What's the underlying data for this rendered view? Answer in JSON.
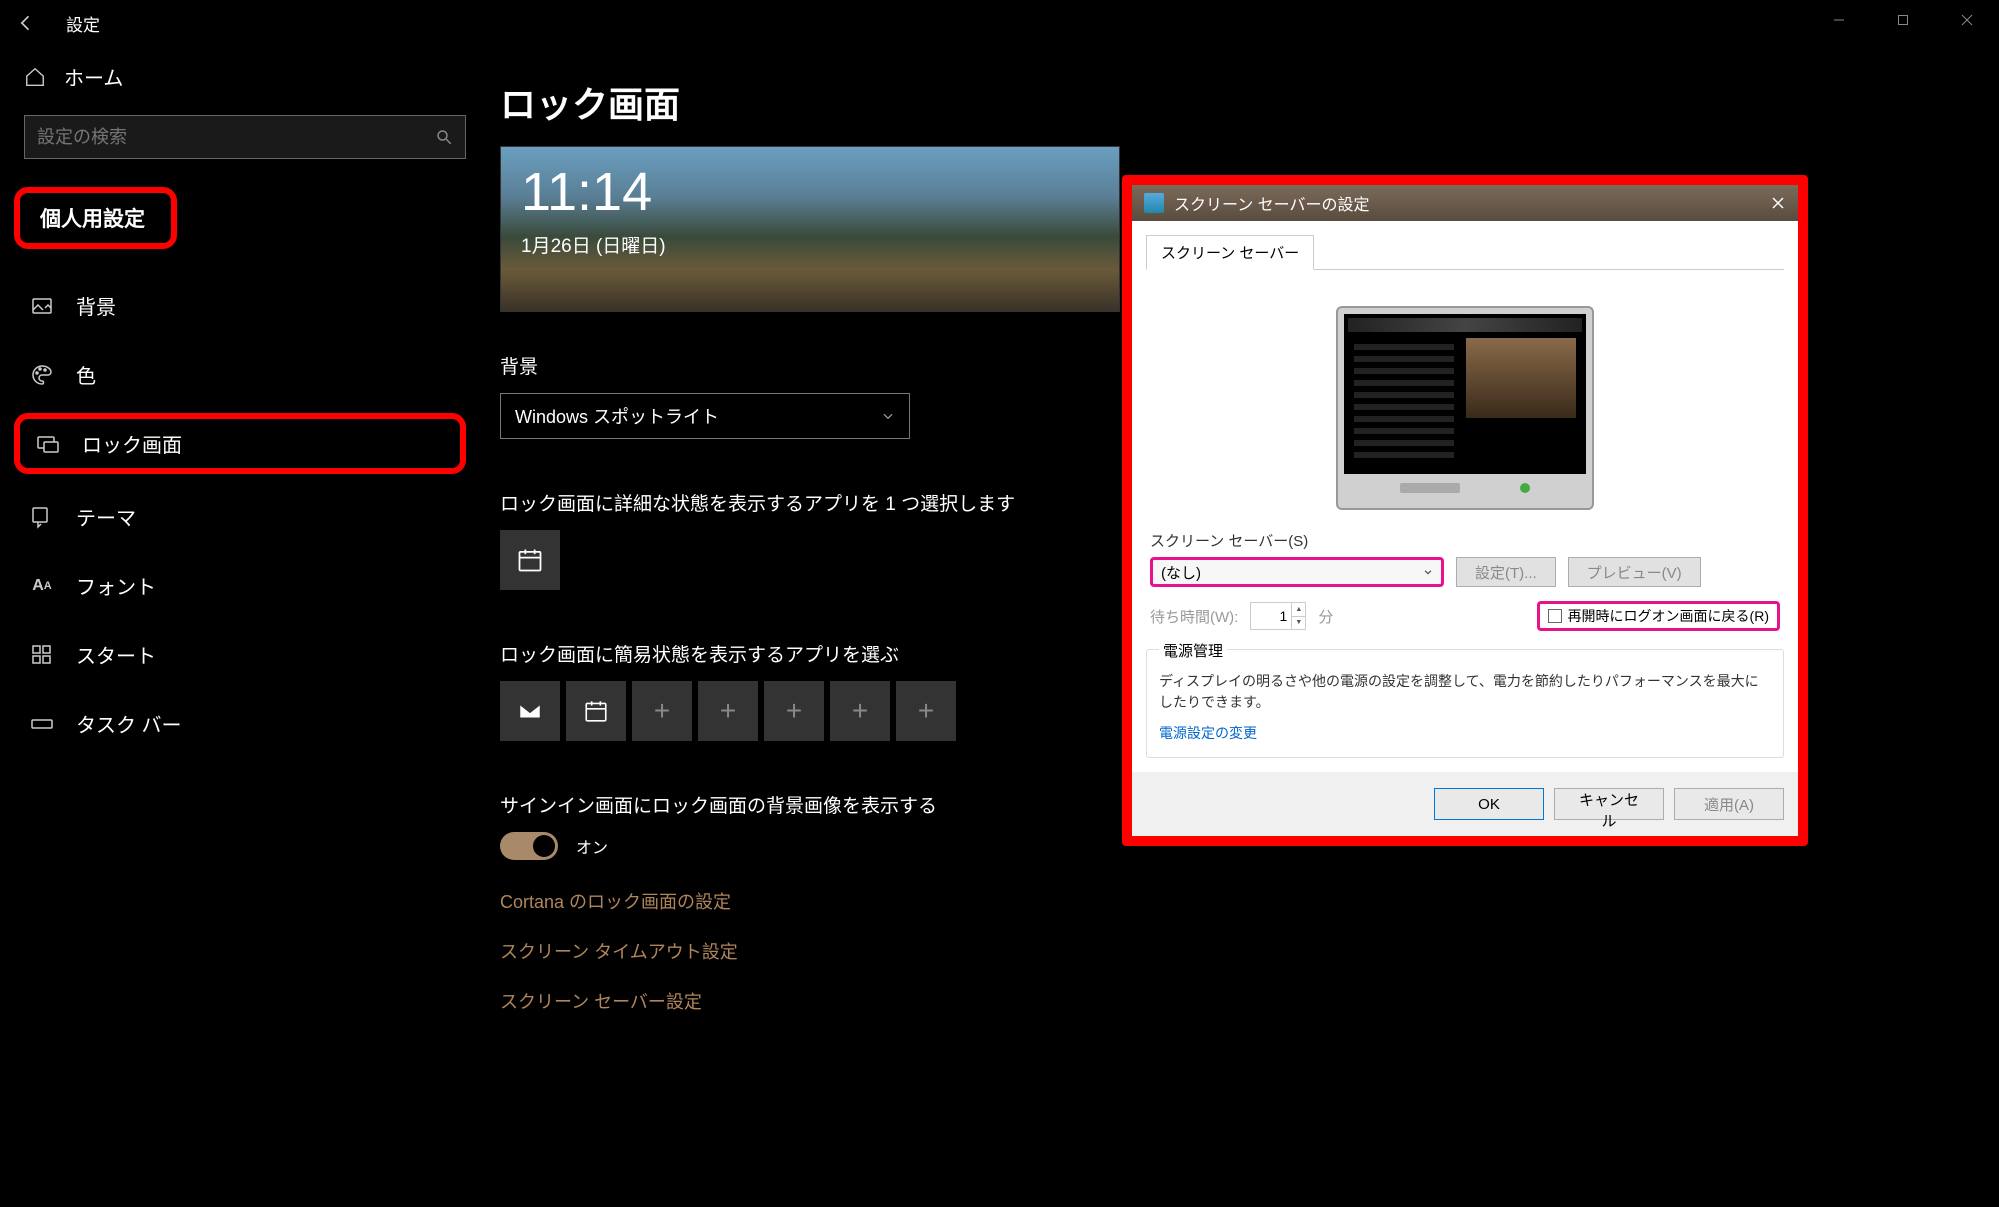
{
  "window": {
    "title": "設定"
  },
  "sidebar": {
    "home": "ホーム",
    "search_placeholder": "設定の検索",
    "category": "個人用設定",
    "items": [
      {
        "label": "背景",
        "icon": "picture"
      },
      {
        "label": "色",
        "icon": "palette"
      },
      {
        "label": "ロック画面",
        "icon": "lock-screen"
      },
      {
        "label": "テーマ",
        "icon": "brush"
      },
      {
        "label": "フォント",
        "icon": "font"
      },
      {
        "label": "スタート",
        "icon": "start"
      },
      {
        "label": "タスク バー",
        "icon": "taskbar"
      }
    ]
  },
  "main": {
    "title": "ロック画面",
    "preview": {
      "time": "11:14",
      "date": "1月26日 (日曜日)"
    },
    "background_label": "背景",
    "background_value": "Windows スポットライト",
    "detail_app_label": "ロック画面に詳細な状態を表示するアプリを 1 つ選択します",
    "quick_app_label": "ロック画面に簡易状態を表示するアプリを選ぶ",
    "signinbg_label": "サインイン画面にロック画面の背景画像を表示する",
    "toggle_on": "オン",
    "links": [
      "Cortana のロック画面の設定",
      "スクリーン タイムアウト設定",
      "スクリーン セーバー設定"
    ]
  },
  "dialog": {
    "title": "スクリーン セーバーの設定",
    "tab": "スクリーン セーバー",
    "ss_label": "スクリーン セーバー(S)",
    "ss_value": "(なし)",
    "btn_settings": "設定(T)...",
    "btn_preview": "プレビュー(V)",
    "wait_label": "待ち時間(W):",
    "wait_value": "1",
    "wait_unit": "分",
    "resume_label": "再開時にログオン画面に戻る(R)",
    "power_title": "電源管理",
    "power_desc": "ディスプレイの明るさや他の電源の設定を調整して、電力を節約したりパフォーマンスを最大にしたりできます。",
    "power_link": "電源設定の変更",
    "btn_ok": "OK",
    "btn_cancel": "キャンセル",
    "btn_apply": "適用(A)"
  }
}
